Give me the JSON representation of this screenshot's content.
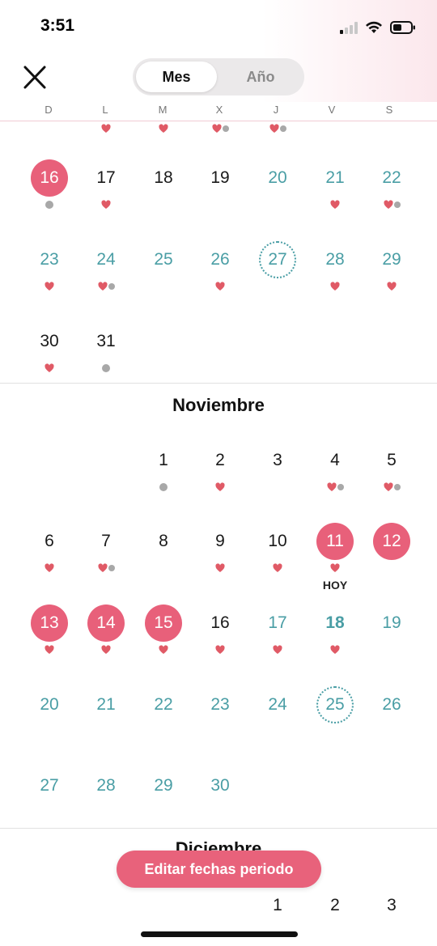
{
  "status_bar": {
    "time": "3:51"
  },
  "header": {
    "close_icon": "close-icon",
    "tabs": [
      {
        "label": "Mes",
        "selected": true
      },
      {
        "label": "Año",
        "selected": false
      }
    ]
  },
  "weekdays": [
    "D",
    "L",
    "M",
    "X",
    "J",
    "V",
    "S"
  ],
  "colors": {
    "period": "#e8607a",
    "fertile": "#4a9ea5",
    "heart": "#e05a66",
    "dot": "#a8a8a8"
  },
  "october": {
    "rows": [
      {
        "days": [
          {
            "d": "",
            "m": []
          },
          {
            "d": "",
            "m": [
              "heart"
            ]
          },
          {
            "d": "",
            "m": [
              "heart"
            ]
          },
          {
            "d": "",
            "m": [
              "heart",
              "dot"
            ]
          },
          {
            "d": "",
            "m": [
              "heart",
              "dot"
            ]
          },
          {
            "d": "",
            "m": []
          },
          {
            "d": "",
            "m": []
          }
        ]
      },
      {
        "days": [
          {
            "d": "16",
            "s": "period",
            "m": [
              "dot"
            ]
          },
          {
            "d": "17",
            "s": "black",
            "m": [
              "heart"
            ]
          },
          {
            "d": "18",
            "s": "black",
            "m": []
          },
          {
            "d": "19",
            "s": "black",
            "m": []
          },
          {
            "d": "20",
            "s": "teal",
            "m": []
          },
          {
            "d": "21",
            "s": "teal",
            "m": [
              "heart"
            ]
          },
          {
            "d": "22",
            "s": "teal",
            "m": [
              "heart",
              "dot"
            ]
          }
        ]
      },
      {
        "days": [
          {
            "d": "23",
            "s": "teal",
            "m": [
              "heart"
            ]
          },
          {
            "d": "24",
            "s": "teal",
            "m": [
              "heart",
              "dot"
            ]
          },
          {
            "d": "25",
            "s": "teal",
            "m": []
          },
          {
            "d": "26",
            "s": "teal",
            "m": [
              "heart"
            ]
          },
          {
            "d": "27",
            "s": "fertile",
            "m": []
          },
          {
            "d": "28",
            "s": "teal",
            "m": [
              "heart"
            ]
          },
          {
            "d": "29",
            "s": "teal",
            "m": [
              "heart"
            ]
          }
        ]
      },
      {
        "days": [
          {
            "d": "30",
            "s": "black",
            "m": [
              "heart"
            ]
          },
          {
            "d": "31",
            "s": "black",
            "m": [
              "dot"
            ]
          }
        ]
      }
    ]
  },
  "november": {
    "title": "Noviembre",
    "today_label": "HOY",
    "rows": [
      {
        "days": [
          null,
          null,
          {
            "d": "1",
            "s": "black",
            "m": [
              "dot"
            ]
          },
          {
            "d": "2",
            "s": "black",
            "m": [
              "heart"
            ]
          },
          {
            "d": "3",
            "s": "black",
            "m": []
          },
          {
            "d": "4",
            "s": "black",
            "m": [
              "heart",
              "dot"
            ]
          },
          {
            "d": "5",
            "s": "black",
            "m": [
              "heart",
              "dot"
            ]
          }
        ]
      },
      {
        "days": [
          {
            "d": "6",
            "s": "black",
            "m": [
              "heart"
            ]
          },
          {
            "d": "7",
            "s": "black",
            "m": [
              "heart",
              "dot"
            ]
          },
          {
            "d": "8",
            "s": "black",
            "m": []
          },
          {
            "d": "9",
            "s": "black",
            "m": [
              "heart"
            ]
          },
          {
            "d": "10",
            "s": "black",
            "m": [
              "heart"
            ]
          },
          {
            "d": "11",
            "s": "period",
            "m": [
              "heart"
            ],
            "today": true
          },
          {
            "d": "12",
            "s": "period",
            "m": []
          }
        ]
      },
      {
        "days": [
          {
            "d": "13",
            "s": "period",
            "m": [
              "heart"
            ]
          },
          {
            "d": "14",
            "s": "period",
            "m": [
              "heart"
            ]
          },
          {
            "d": "15",
            "s": "period",
            "m": [
              "heart"
            ]
          },
          {
            "d": "16",
            "s": "black",
            "m": [
              "heart"
            ]
          },
          {
            "d": "17",
            "s": "teal",
            "m": [
              "heart"
            ]
          },
          {
            "d": "18",
            "s": "today",
            "m": [
              "heart"
            ]
          },
          {
            "d": "19",
            "s": "teal",
            "m": []
          }
        ]
      },
      {
        "days": [
          {
            "d": "20",
            "s": "teal",
            "m": []
          },
          {
            "d": "21",
            "s": "teal",
            "m": []
          },
          {
            "d": "22",
            "s": "teal",
            "m": []
          },
          {
            "d": "23",
            "s": "teal",
            "m": []
          },
          {
            "d": "24",
            "s": "teal",
            "m": []
          },
          {
            "d": "25",
            "s": "fertile",
            "m": []
          },
          {
            "d": "26",
            "s": "teal",
            "m": []
          }
        ]
      },
      {
        "days": [
          {
            "d": "27",
            "s": "teal",
            "m": []
          },
          {
            "d": "28",
            "s": "teal",
            "m": []
          },
          {
            "d": "29",
            "s": "teal",
            "m": []
          },
          {
            "d": "30",
            "s": "teal",
            "m": []
          }
        ]
      }
    ]
  },
  "december": {
    "title": "Diciembre",
    "visible_days": [
      {
        "d": "1",
        "col": 4
      },
      {
        "d": "2",
        "col": 5
      },
      {
        "d": "3",
        "col": 6
      }
    ]
  },
  "cta": {
    "label": "Editar fechas periodo"
  }
}
